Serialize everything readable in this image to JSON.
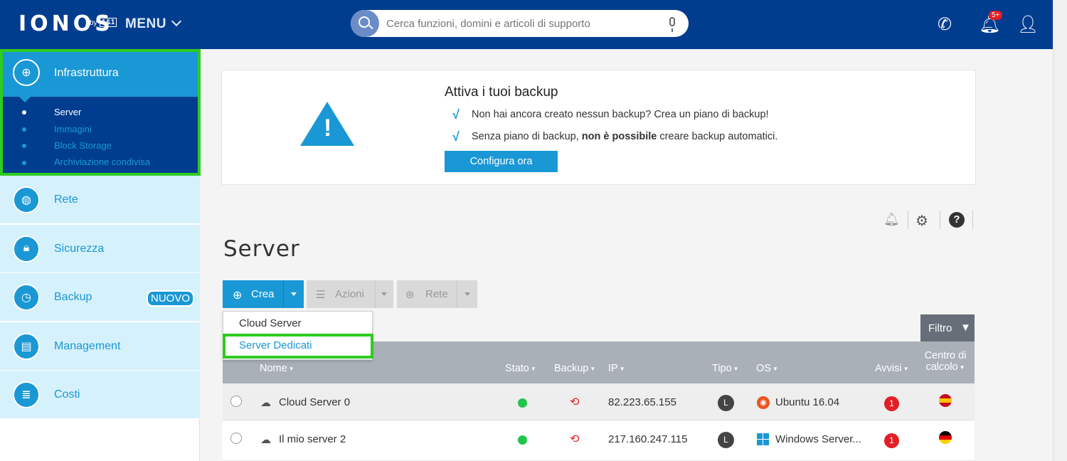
{
  "header": {
    "logo": "IONOS",
    "logo_by": "by",
    "logo_11": "1&1",
    "menu_label": "MENU",
    "search_placeholder": "Cerca funzioni, domini e articoli di supporto",
    "notification_count": "5+"
  },
  "sidebar": {
    "infra": {
      "label": "Infrastruttura",
      "subitems": [
        "Server",
        "Immagini",
        "Block Storage",
        "Archiviazione condivisa"
      ]
    },
    "items": [
      {
        "label": "Rete",
        "icon": "globe-icon"
      },
      {
        "label": "Sicurezza",
        "icon": "lock-icon"
      },
      {
        "label": "Backup",
        "icon": "clock-icon",
        "badge": "NUOVO"
      },
      {
        "label": "Management",
        "icon": "clipboard-icon"
      },
      {
        "label": "Costi",
        "icon": "coins-icon"
      }
    ]
  },
  "banner": {
    "title": "Attiva i tuoi backup",
    "line1": "Non hai ancora creato nessun backup? Crea un piano di backup!",
    "line2_pre": "Senza piano di backup, ",
    "line2_bold": "non è possibile",
    "line2_post": " creare backup automatici.",
    "button": "Configura ora"
  },
  "page_title": "Server",
  "toolbar": {
    "crea": "Crea",
    "azioni": "Azioni",
    "rete": "Rete"
  },
  "dropdown": [
    "Cloud Server",
    "Server Dedicati"
  ],
  "filter_label": "Filtro",
  "table": {
    "headers": {
      "nome": "Nome",
      "stato": "Stato",
      "backup": "Backup",
      "ip": "IP",
      "tipo": "Tipo",
      "os": "OS",
      "avvisi": "Avvisi",
      "centro1": "Centro di",
      "centro2": "calcolo"
    },
    "rows": [
      {
        "name": "Cloud Server 0",
        "status": "online",
        "ip": "82.223.65.155",
        "tipo": "L",
        "os": "Ubuntu 16.04",
        "avvisi": "1",
        "datacenter": "Spain"
      },
      {
        "name": "Il mio server 2",
        "status": "online",
        "ip": "217.160.247.115",
        "tipo": "L",
        "os": "Windows Server...",
        "avvisi": "1",
        "datacenter": "Germany"
      }
    ]
  },
  "colors": {
    "brand": "#003d8f",
    "accent": "#1a98d5",
    "highlight": "#2ecc1f",
    "status_ok": "#22c449",
    "alert": "#e21f26"
  }
}
